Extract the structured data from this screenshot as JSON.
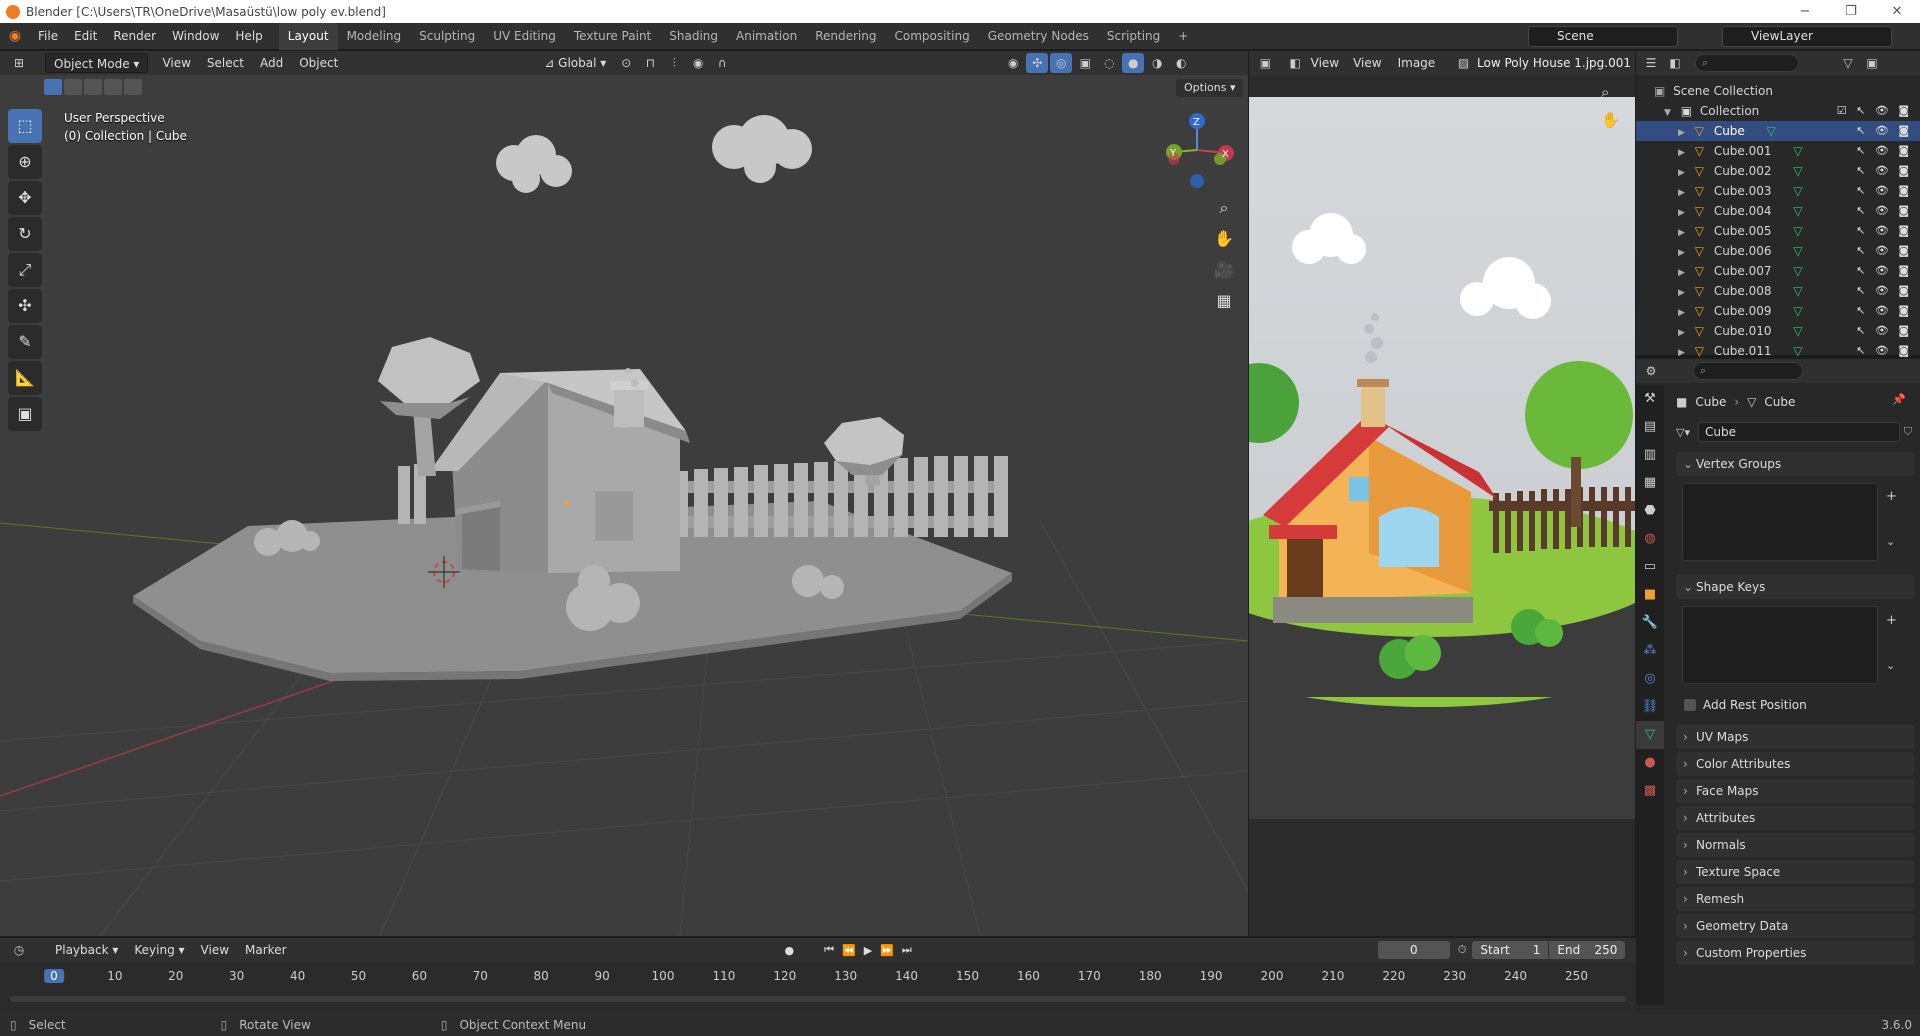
{
  "window": {
    "title": "Blender [C:\\Users\\TR\\OneDrive\\Masaüstü\\low poly ev.blend]",
    "controls": [
      "−",
      "❐",
      "✕"
    ]
  },
  "menu": [
    "File",
    "Edit",
    "Render",
    "Window",
    "Help"
  ],
  "workspaces": [
    {
      "label": "Layout",
      "active": true
    },
    {
      "label": "Modeling"
    },
    {
      "label": "Sculpting"
    },
    {
      "label": "UV Editing"
    },
    {
      "label": "Texture Paint"
    },
    {
      "label": "Shading"
    },
    {
      "label": "Animation"
    },
    {
      "label": "Rendering"
    },
    {
      "label": "Compositing"
    },
    {
      "label": "Geometry Nodes"
    },
    {
      "label": "Scripting"
    }
  ],
  "scene": {
    "name": "Scene",
    "view_layer": "ViewLayer"
  },
  "viewport": {
    "mode": "Object Mode",
    "menus": [
      "View",
      "Select",
      "Add",
      "Object"
    ],
    "transform_orientation": "Global",
    "options_label": "Options",
    "info_line1": "User Perspective",
    "info_line2": "(0) Collection | Cube",
    "gizmo": {
      "x": "X",
      "y": "Y",
      "z": "Z"
    },
    "colors": {
      "background": "#3d3d3d",
      "grid": "#474747",
      "x_axis": "#9b3a45",
      "y_axis": "#6b8a2a",
      "model": "#9a9a9a",
      "active_tool": "#4772b3"
    }
  },
  "image_editor": {
    "menus": [
      "View",
      "View",
      "Image"
    ],
    "image_name": "Low Poly House 1.jpg.001"
  },
  "outliner": {
    "root": "Scene Collection",
    "collection": "Collection",
    "items": [
      "Cube",
      "Cube.001",
      "Cube.002",
      "Cube.003",
      "Cube.004",
      "Cube.005",
      "Cube.006",
      "Cube.007",
      "Cube.008",
      "Cube.009",
      "Cube.010",
      "Cube.011"
    ]
  },
  "properties": {
    "breadcrumb_object": "Cube",
    "breadcrumb_mesh": "Cube",
    "mesh_name": "Cube",
    "open_panels": [
      "Vertex Groups",
      "Shape Keys"
    ],
    "add_rest_position": "Add Rest Position",
    "closed_panels": [
      "UV Maps",
      "Color Attributes",
      "Face Maps",
      "Attributes",
      "Normals",
      "Texture Space",
      "Remesh",
      "Geometry Data",
      "Custom Properties"
    ]
  },
  "timeline": {
    "menus": [
      "Playback",
      "Keying",
      "View",
      "Marker"
    ],
    "current_frame": "0",
    "start_label": "Start",
    "start": "1",
    "end_label": "End",
    "end": "250",
    "ticks": [
      "0",
      "10",
      "20",
      "30",
      "40",
      "50",
      "60",
      "70",
      "80",
      "90",
      "100",
      "110",
      "120",
      "130",
      "140",
      "150",
      "160",
      "170",
      "180",
      "190",
      "200",
      "210",
      "220",
      "230",
      "240",
      "250"
    ]
  },
  "status": {
    "select": "Select",
    "rotate": "Rotate View",
    "context": "Object Context Menu",
    "version": "3.6.0"
  }
}
